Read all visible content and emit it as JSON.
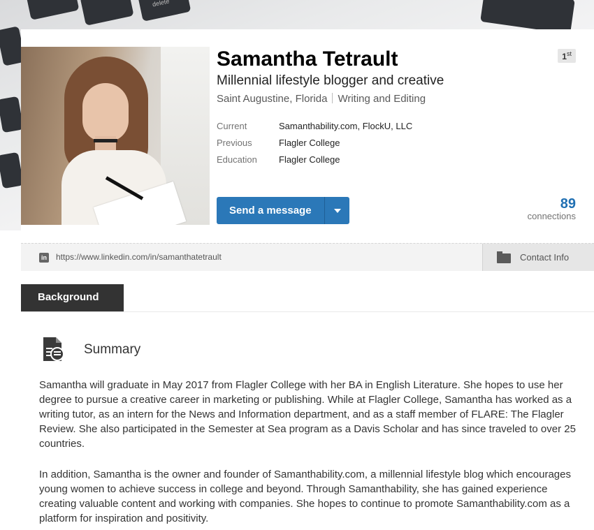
{
  "hero": {
    "keycap_text": "delete"
  },
  "profile": {
    "name": "Samantha Tetrault",
    "headline": "Millennial lifestyle blogger and creative",
    "location": "Saint Augustine, Florida",
    "industry": "Writing and Editing",
    "degree": "1",
    "degree_suffix": "st",
    "facts": [
      {
        "label": "Current",
        "value": "Samanthability.com, FlockU, LLC"
      },
      {
        "label": "Previous",
        "value": "Flagler College"
      },
      {
        "label": "Education",
        "value": "Flagler College"
      }
    ],
    "message_button": "Send a message",
    "connections_count": "89",
    "connections_label": "connections"
  },
  "url_bar": {
    "icon": "linkedin-icon",
    "url": "https://www.linkedin.com/in/samanthatetrault",
    "contact_label": "Contact Info"
  },
  "background": {
    "tab_label": "Background",
    "summary_title": "Summary",
    "paragraphs": [
      "Samantha will graduate in May 2017 from Flagler College with her BA in English Literature. She hopes to use her degree to pursue a creative career in marketing or publishing. While at Flagler College, Samantha has worked as a writing tutor, as an intern for the News and Information department, and as a staff member of FLARE: The Flagler Review. She also participated in the Semester at Sea program as a Davis Scholar and has since traveled to over 25 countries.",
      "In addition, Samantha is the owner and founder of Samanthability.com, a millennial lifestyle blog which encourages young women to achieve success in college and beyond. Through Samanthability, she has gained experience creating valuable content and working with companies. She hopes to continue to promote Samanthability.com as a platform for inspiration and positivity."
    ]
  },
  "colors": {
    "primary_button": "#2b78b8",
    "connections": "#1f6fb2",
    "tab_bg": "#333333"
  }
}
